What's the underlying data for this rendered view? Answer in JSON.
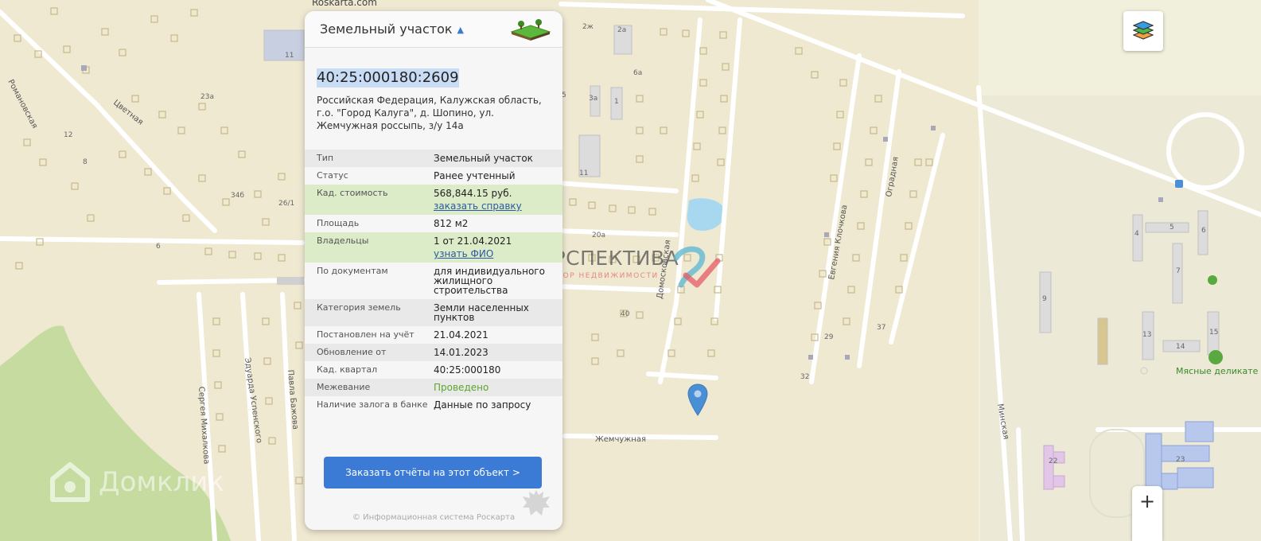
{
  "map": {
    "source_top": "Roskarta.com",
    "streets": [
      "Цветная",
      "Романовская",
      "Эдуарда Успенского",
      "Павла Бажова",
      "Сергея Михалкова",
      "Домосковская",
      "Евгения Клочкова",
      "Оградная",
      "Минская",
      "Жемчужная"
    ],
    "house_numbers": [
      "11",
      "23а",
      "12",
      "8",
      "34б",
      "26/1",
      "6",
      "2ж",
      "2а",
      "6а",
      "5",
      "3а",
      "1",
      "11",
      "20а",
      "40",
      "37",
      "29",
      "32",
      "4",
      "5",
      "6",
      "7",
      "9",
      "13",
      "14",
      "15",
      "22",
      "23"
    ],
    "shop_label": "Мясные деликате",
    "watermark_perspektiva": "ПЕРСПЕКТИВА",
    "watermark_perspektiva_sub": "ОПЕРАТОР НЕДВИЖИМОСТИ",
    "watermark_domclick": "Домклик"
  },
  "panel": {
    "title": "Земельный участок",
    "cadastral_number": "40:25:000180:2609",
    "address": "Российская Федерация, Калужская область, г.о. \"Город Калуга\", д. Шопино, ул. Жемчужная россыпь, з/у 14а",
    "rows": [
      {
        "key": "Тип",
        "value": "Земельный участок"
      },
      {
        "key": "Статус",
        "value": "Ранее учтенный"
      },
      {
        "key": "Кад. стоимость",
        "value": "568,844.15 руб.",
        "link": "заказать справку"
      },
      {
        "key": "Площадь",
        "value": "812 м2"
      },
      {
        "key": "Владельцы",
        "value": "1 от 21.04.2021",
        "link": "узнать ФИО"
      },
      {
        "key": "По документам",
        "value": "для индивидуального жилищного строительства"
      },
      {
        "key": "Категория земель",
        "value": "Земли населенных пунктов"
      },
      {
        "key": "Постановлен на учёт",
        "value": "21.04.2021"
      },
      {
        "key": "Обновление от",
        "value": "14.01.2023"
      },
      {
        "key": "Кад. квартал",
        "value": "40:25:000180"
      },
      {
        "key": "Межевание",
        "value": "Проведено"
      },
      {
        "key": "Наличие залога в банке",
        "value": "Данные по запросу"
      }
    ],
    "order_button": "Заказать отчёты на этот объект >",
    "copyright": "© Информационная система Роскарта"
  },
  "controls": {
    "zoom_in": "+"
  },
  "colors": {
    "accent": "#3b7ad5",
    "highlight": "#c9dcf5",
    "green_row": "#dcebc8",
    "ok_text": "#5da52c"
  }
}
